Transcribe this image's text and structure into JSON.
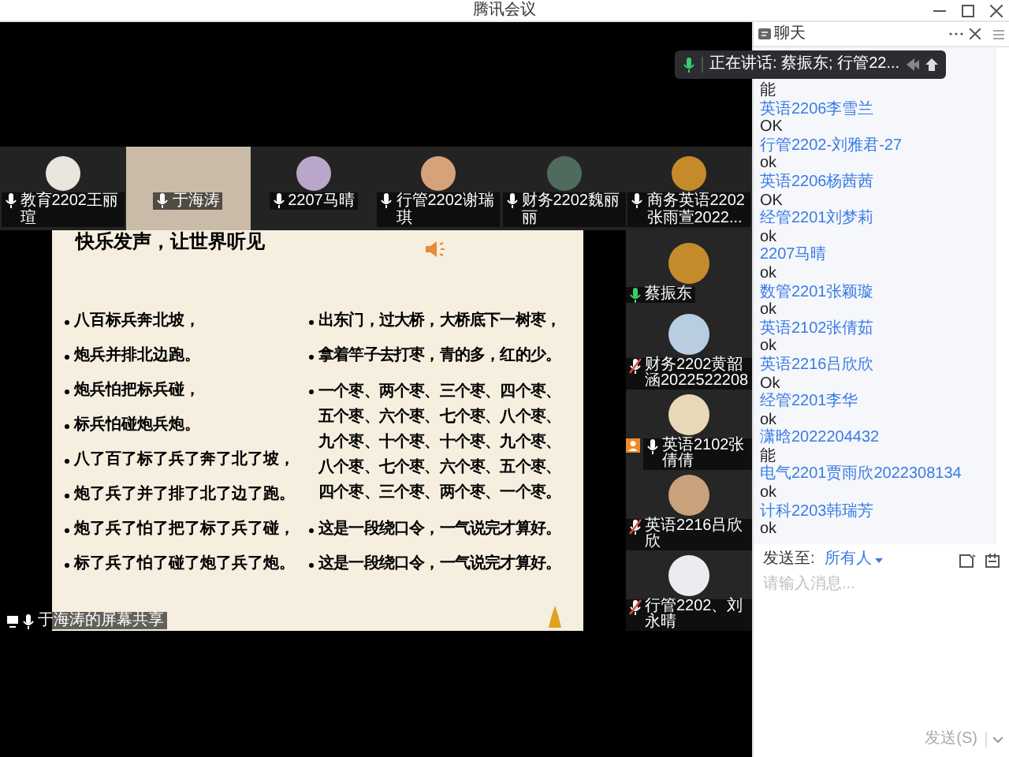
{
  "window": {
    "title": "腾讯会议"
  },
  "speaking_banner": {
    "text": "正在讲话: 蔡振东; 行管22..."
  },
  "strip": [
    {
      "name": "教育2202王丽瑄",
      "muted": false,
      "video": false
    },
    {
      "name": "于海涛",
      "muted": false,
      "video": true
    },
    {
      "name": "2207马晴",
      "muted": false,
      "video": false
    },
    {
      "name": "行管2202谢瑞琪",
      "muted": false,
      "video": false
    },
    {
      "name": "财务2202魏丽丽",
      "muted": false,
      "video": false
    },
    {
      "name": "商务英语2202张雨萱2022...",
      "muted": false,
      "video": false
    }
  ],
  "side_participants": [
    {
      "name": "蔡振东",
      "muted": false,
      "speaking": true,
      "badge": false
    },
    {
      "name": "财务2202黄韶涵2022522208",
      "muted": true,
      "speaking": false,
      "badge": false
    },
    {
      "name": "英语2102张倩倩",
      "muted": false,
      "speaking": false,
      "badge": true
    },
    {
      "name": "英语2216吕欣欣",
      "muted": true,
      "speaking": false,
      "badge": false
    },
    {
      "name": "行管2202、刘永晴",
      "muted": true,
      "speaking": false,
      "badge": false
    }
  ],
  "screen_share": {
    "name": "于海涛的屏幕共享"
  },
  "slide": {
    "title": "快乐发声，让世界听见",
    "left_items": [
      "八百标兵奔北坡，",
      "炮兵并排北边跑。",
      "炮兵怕把标兵碰，",
      "标兵怕碰炮兵炮。",
      "八了百了标了兵了奔了北了坡，",
      "炮了兵了并了排了北了边了跑。",
      "炮了兵了怕了把了标了兵了碰，",
      "标了兵了怕了碰了炮了兵了炮。"
    ],
    "right_items": [
      {
        "lines": [
          "出东门，过大桥，大桥底下一树枣，"
        ]
      },
      {
        "lines": [
          "拿着竿子去打枣，青的多，红的少。"
        ]
      },
      {
        "lines": [
          "一个枣、两个枣、三个枣、四个枣、",
          "五个枣、六个枣、七个枣、八个枣、",
          "九个枣、十个枣、十个枣、九个枣、",
          "八个枣、七个枣、六个枣、五个枣、",
          "四个枣、三个枣、两个枣、一个枣。"
        ]
      },
      {
        "lines": [
          "这是一段绕口令，一气说完才算好。"
        ]
      },
      {
        "lines": [
          "这是一段绕口令，一气说完才算好。"
        ]
      }
    ]
  },
  "chat": {
    "title": "聊天",
    "messages": [
      {
        "text": "能"
      },
      {
        "sender": "英语2206李雪兰",
        "text": "OK"
      },
      {
        "sender": "行管2202-刘雅君-27",
        "text": "ok"
      },
      {
        "sender": "英语2206杨茜茜",
        "text": "OK"
      },
      {
        "sender": "经管2201刘梦莉",
        "text": "ok"
      },
      {
        "sender": "2207马晴",
        "text": "ok"
      },
      {
        "sender": "数管2201张颖璇",
        "text": "ok"
      },
      {
        "sender": "英语2102张倩茹",
        "text": "ok"
      },
      {
        "sender": "英语2216吕欣欣",
        "text": "Ok"
      },
      {
        "sender": "经管2201李华",
        "text": "ok"
      },
      {
        "sender": "潇晗2022204432",
        "text": "能"
      },
      {
        "sender": "电气2201贾雨欣2022308134",
        "text": "ok"
      },
      {
        "sender": "计科2203韩瑞芳",
        "text": "ok"
      }
    ],
    "send_to_label": "发送至:",
    "recipient": "所有人",
    "placeholder": "请输入消息...",
    "send_button": "发送(S)"
  }
}
